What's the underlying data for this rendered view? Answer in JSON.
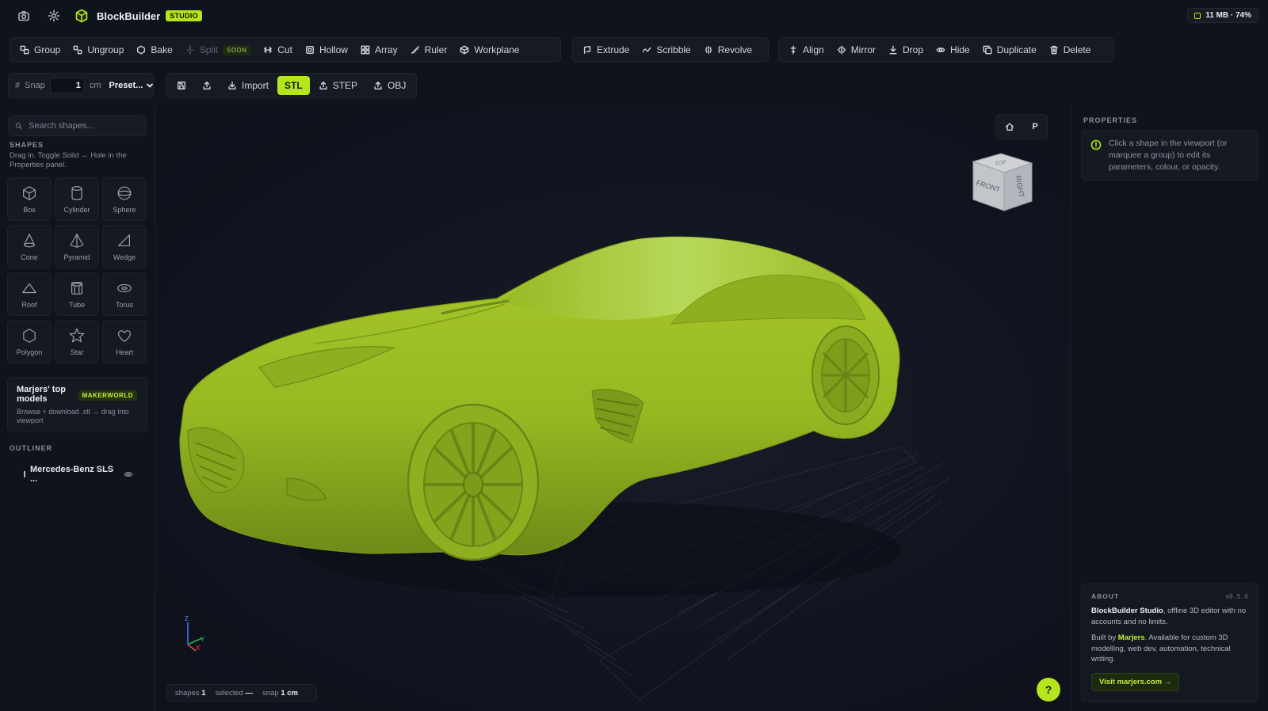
{
  "header": {
    "app_name": "BlockBuilder",
    "badge": "STUDIO",
    "memory": "11 MB · 74%",
    "accent_color": "#b5e61d"
  },
  "toolbar": {
    "group1": [
      {
        "label": "Group",
        "icon": "group-icon"
      },
      {
        "label": "Ungroup",
        "icon": "ungroup-icon"
      },
      {
        "label": "Bake",
        "icon": "bake-icon"
      },
      {
        "label": "Split",
        "icon": "split-icon",
        "badge": "SOON"
      },
      {
        "label": "Cut",
        "icon": "cut-icon"
      },
      {
        "label": "Hollow",
        "icon": "hollow-icon"
      },
      {
        "label": "Array",
        "icon": "array-icon"
      },
      {
        "label": "Ruler",
        "icon": "ruler-icon"
      },
      {
        "label": "Workplane",
        "icon": "workplane-icon"
      }
    ],
    "group2": [
      {
        "label": "Extrude",
        "icon": "extrude-icon"
      },
      {
        "label": "Scribble",
        "icon": "scribble-icon"
      },
      {
        "label": "Revolve",
        "icon": "revolve-icon"
      }
    ],
    "group3": [
      {
        "label": "Align",
        "icon": "align-icon"
      },
      {
        "label": "Mirror",
        "icon": "mirror-icon"
      },
      {
        "label": "Drop",
        "icon": "drop-icon"
      },
      {
        "label": "Hide",
        "icon": "eye-icon"
      },
      {
        "label": "Duplicate",
        "icon": "duplicate-icon"
      },
      {
        "label": "Delete",
        "icon": "trash-icon"
      }
    ]
  },
  "snap": {
    "label": "Snap",
    "value": "1",
    "unit": "cm",
    "preset": "Preset..."
  },
  "file": {
    "import": "Import",
    "stl": "STL",
    "step": "STEP",
    "obj": "OBJ"
  },
  "sidebar": {
    "search_placeholder": "Search shapes...",
    "shapes_title": "SHAPES",
    "shapes_hint": "Drag in. Toggle Solid ↔ Hole in the Properties panel.",
    "shapes": [
      "Box",
      "Cylinder",
      "Sphere",
      "Cone",
      "Pyramid",
      "Wedge",
      "Roof",
      "Tube",
      "Torus",
      "Polygon",
      "Star",
      "Heart"
    ],
    "promo_title": "Marjers' top models",
    "promo_badge": "MAKERWORLD",
    "promo_sub": "Browse + download .stl → drag into viewport",
    "outliner_title": "OUTLINER",
    "outliner_item": "Mercedes-Benz SLS ..."
  },
  "viewport": {
    "home_icon": "home-icon",
    "projection": "P",
    "cube_front": "FRONT",
    "cube_right": "RIGHT",
    "cube_top": "TOP",
    "axis_x": "X",
    "axis_y": "Y",
    "axis_z": "Z",
    "status_shapes_label": "shapes",
    "status_shapes_value": "1",
    "status_selected_label": "selected",
    "status_selected_value": "—",
    "status_snap_label": "snap",
    "status_snap_value": "1 cm",
    "help": "?",
    "model_color": "#9fbf25"
  },
  "properties": {
    "title": "PROPERTIES",
    "hint": "Click a shape in the viewport (or marquee a group) to edit its parameters, colour, or opacity."
  },
  "about": {
    "title": "ABOUT",
    "version": "v0.5.0",
    "p1_bold": "BlockBuilder Studio",
    "p1_rest": ", offline 3D editor with no accounts and no limits.",
    "p2_pre": "Built by ",
    "p2_name": "Marjers",
    "p2_rest": ". Available for custom 3D modelling, web dev, automation, technical writing.",
    "visit": "Visit marjers.com →"
  }
}
